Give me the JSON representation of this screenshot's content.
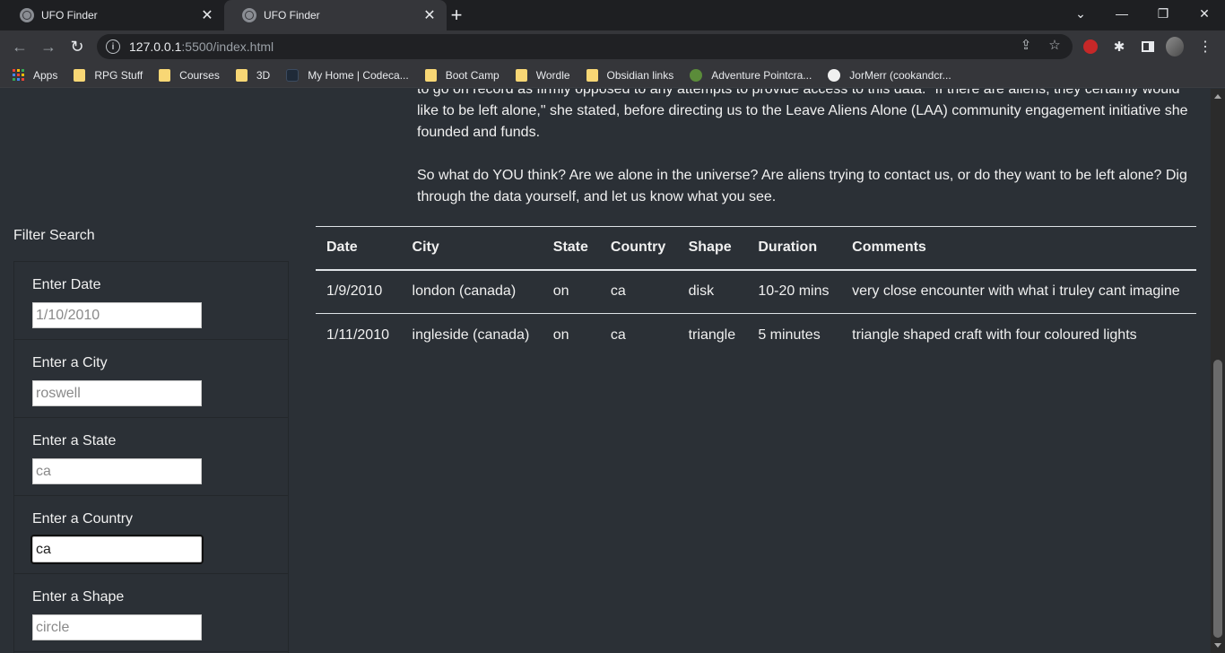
{
  "browser": {
    "tabs": [
      {
        "title": "UFO Finder",
        "active": false
      },
      {
        "title": "UFO Finder",
        "active": true
      }
    ],
    "url_host": "127.0.0.1",
    "url_rest": ":5500/index.html",
    "bookmarks": [
      {
        "label": "Apps",
        "icon": "apps-grid-icon"
      },
      {
        "label": "RPG Stuff",
        "icon": "folder-icon"
      },
      {
        "label": "Courses",
        "icon": "folder-icon"
      },
      {
        "label": "3D",
        "icon": "folder-icon"
      },
      {
        "label": "My Home | Codeca...",
        "icon": "codecademy-icon"
      },
      {
        "label": "Boot Camp",
        "icon": "folder-icon"
      },
      {
        "label": "Wordle",
        "icon": "folder-icon"
      },
      {
        "label": "Obsidian links",
        "icon": "folder-icon"
      },
      {
        "label": "Adventure Pointcra...",
        "icon": "pointcrawl-icon"
      },
      {
        "label": "JorMerr (cookandcr...",
        "icon": "github-icon"
      }
    ]
  },
  "article": {
    "para1": "to go on record as firmly opposed to any attempts to provide access to this data. \"If there are aliens, they certainly would like to be left alone,\" she stated, before directing us to the Leave Aliens Alone (LAA) community engagement initiative she founded and funds.",
    "para2": "So what do YOU think? Are we alone in the universe? Are aliens trying to contact us, or do they want to be left alone? Dig through the data yourself, and let us know what you see."
  },
  "filters": {
    "title": "Filter Search",
    "items": [
      {
        "label": "Enter Date",
        "placeholder": "1/10/2010",
        "value": ""
      },
      {
        "label": "Enter a City",
        "placeholder": "roswell",
        "value": ""
      },
      {
        "label": "Enter a State",
        "placeholder": "ca",
        "value": ""
      },
      {
        "label": "Enter a Country",
        "placeholder": "ca",
        "value": "ca"
      },
      {
        "label": "Enter a Shape",
        "placeholder": "circle",
        "value": ""
      }
    ]
  },
  "table": {
    "headers": [
      "Date",
      "City",
      "State",
      "Country",
      "Shape",
      "Duration",
      "Comments"
    ],
    "rows": [
      [
        "1/9/2010",
        "london (canada)",
        "on",
        "ca",
        "disk",
        "10-20 mins",
        "very close encounter with what i truley cant imagine"
      ],
      [
        "1/11/2010",
        "ingleside (canada)",
        "on",
        "ca",
        "triangle",
        "5 minutes",
        "triangle shaped craft with four coloured lights"
      ]
    ]
  }
}
